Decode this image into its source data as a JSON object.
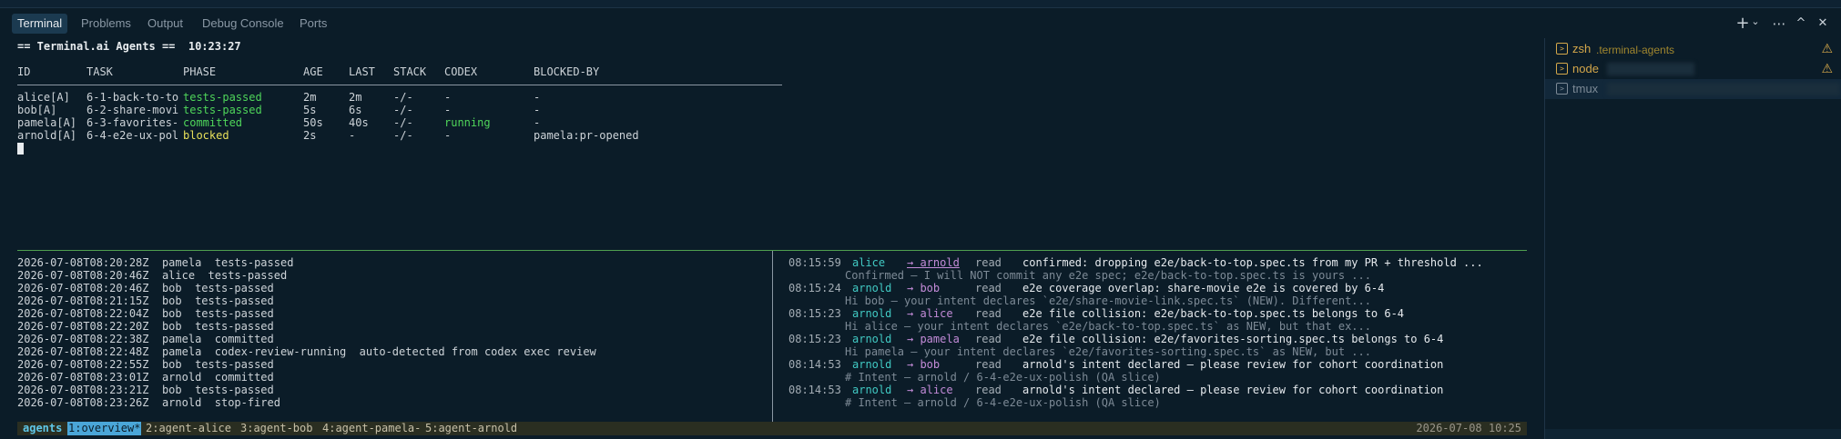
{
  "panel_tabs": [
    {
      "label": "Terminal",
      "active": true
    },
    {
      "label": "Problems"
    },
    {
      "label": "Output"
    },
    {
      "label": "Debug Console"
    },
    {
      "label": "Ports"
    }
  ],
  "toolbar": {
    "add": "+",
    "dropdown": "⌄",
    "more": "⋯",
    "maximize": "^",
    "close": "✕"
  },
  "dashboard": {
    "title": "== Terminal.ai Agents ==",
    "clock": "10:23:27",
    "headers": {
      "id": "ID",
      "task": "TASK",
      "phase": "PHASE",
      "age": "AGE",
      "last": "LAST",
      "stack": "STACK",
      "codex": "CODEX",
      "blocked_by": "BLOCKED-BY"
    },
    "rows": [
      {
        "id": "alice[A]",
        "task": "6-1-back-to-to",
        "phase": "tests-passed",
        "phase_color": "#4fd65a",
        "age": "2m",
        "last": "2m",
        "stack": "-/-",
        "codex": "-",
        "blocked_by": "-"
      },
      {
        "id": "bob[A]",
        "task": "6-2-share-movi",
        "phase": "tests-passed",
        "phase_color": "#4fd65a",
        "age": "5s",
        "last": "6s",
        "stack": "-/-",
        "codex": "-",
        "blocked_by": "-"
      },
      {
        "id": "pamela[A]",
        "task": "6-3-favorites-",
        "phase": "committed",
        "phase_color": "#4fd65a",
        "age": "50s",
        "last": "40s",
        "stack": "-/-",
        "codex": "running",
        "blocked_by": "-"
      },
      {
        "id": "arnold[A]",
        "task": "6-4-e2e-ux-pol",
        "phase": "blocked",
        "phase_color": "#e7e05a",
        "age": "2s",
        "last": "-",
        "stack": "-/-",
        "codex": "-",
        "blocked_by": "pamela:pr-opened"
      }
    ]
  },
  "event_log": [
    "2026-07-08T08:20:28Z  pamela  tests-passed",
    "2026-07-08T08:20:46Z  alice  tests-passed",
    "2026-07-08T08:20:46Z  bob  tests-passed",
    "2026-07-08T08:21:15Z  bob  tests-passed",
    "2026-07-08T08:22:04Z  bob  tests-passed",
    "2026-07-08T08:22:20Z  bob  tests-passed",
    "2026-07-08T08:22:38Z  pamela  committed",
    "2026-07-08T08:22:48Z  pamela  codex-review-running  auto-detected from codex exec review",
    "2026-07-08T08:22:55Z  bob  tests-passed",
    "2026-07-08T08:23:01Z  arnold  committed",
    "2026-07-08T08:23:21Z  bob  tests-passed",
    "2026-07-08T08:23:26Z  arnold  stop-fired"
  ],
  "messages": [
    {
      "time": "08:15:59",
      "from": "alice",
      "to": "→ arnold",
      "underline": true,
      "status": "read",
      "body": "confirmed: dropping e2e/back-to-top.spec.ts from my PR + threshold ...",
      "detail": "Confirmed — I will NOT commit any e2e spec; e2e/back-to-top.spec.ts is yours ..."
    },
    {
      "time": "08:15:24",
      "from": "arnold",
      "to": "→ bob",
      "status": "read",
      "body": "e2e coverage overlap: share-movie e2e is covered by 6-4",
      "detail": "Hi bob — your intent declares `e2e/share-movie-link.spec.ts` (NEW). Different..."
    },
    {
      "time": "08:15:23",
      "from": "arnold",
      "to": "→ alice",
      "status": "read",
      "body": "e2e file collision: e2e/back-to-top.spec.ts belongs to 6-4",
      "detail": "Hi alice — your intent declares `e2e/back-to-top.spec.ts` as NEW, but that ex..."
    },
    {
      "time": "08:15:23",
      "from": "arnold",
      "to": "→ pamela",
      "status": "read",
      "body": "e2e file collision: e2e/favorites-sorting.spec.ts belongs to 6-4",
      "detail": "Hi pamela — your intent declares `e2e/favorites-sorting.spec.ts` as NEW, but ..."
    },
    {
      "time": "08:14:53",
      "from": "arnold",
      "to": "→ bob",
      "status": "read",
      "body": "arnold's intent declared — please review for cohort coordination",
      "detail": "# Intent — arnold / 6-4-e2e-ux-polish (QA slice)"
    },
    {
      "time": "08:14:53",
      "from": "arnold",
      "to": "→ alice",
      "status": "read",
      "body": "arnold's intent declared — please review for cohort coordination",
      "detail": "# Intent — arnold / 6-4-e2e-ux-polish (QA slice)"
    }
  ],
  "status_bar": {
    "session": "agents",
    "active_window": "1:overview*",
    "windows": [
      "2:agent-alice",
      "3:agent-bob",
      "4:agent-pamela-",
      "5:agent-arnold"
    ],
    "datetime": "2026-07-08 10:25"
  },
  "sidebar": [
    {
      "icon": "terminal-icon",
      "name": "zsh",
      "sub": ".terminal-agents",
      "warning": true
    },
    {
      "icon": "terminal-icon",
      "name": "node",
      "sub": "",
      "warning": true
    },
    {
      "icon": "terminal-icon",
      "name": "tmux",
      "sub": "",
      "warning": false
    }
  ],
  "colors": {
    "background": "#0b1c28",
    "green": "#4fd65a",
    "yellow": "#e7e05a",
    "cyan": "#41c9c3",
    "magenta": "#c38bd8",
    "warning": "#d4a74a"
  }
}
